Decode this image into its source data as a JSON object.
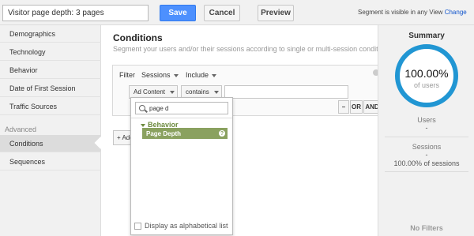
{
  "topbar": {
    "segment_name": "Visitor page depth: 3 pages",
    "save_label": "Save",
    "cancel_label": "Cancel",
    "preview_label": "Preview",
    "visibility_text": "Segment is visible in any View",
    "change_label": "Change"
  },
  "sidebar": {
    "items": [
      {
        "label": "Demographics"
      },
      {
        "label": "Technology"
      },
      {
        "label": "Behavior"
      },
      {
        "label": "Date of First Session"
      },
      {
        "label": "Traffic Sources"
      }
    ],
    "advanced_heading": "Advanced",
    "advanced_items": [
      {
        "label": "Conditions",
        "active": true
      },
      {
        "label": "Sequences"
      }
    ]
  },
  "main": {
    "title": "Conditions",
    "subtitle": "Segment your users and/or their sessions according to single or multi-session conditions.",
    "filter": {
      "label": "Filter",
      "scope": "Sessions",
      "mode": "Include",
      "dimension": "Ad Content",
      "operator": "contains",
      "value": "",
      "minus_label": "–",
      "or_label": "OR",
      "and_label": "AND"
    },
    "add_label": "+ Add"
  },
  "dropdown": {
    "search_value": "page d",
    "group_label": "Behavior",
    "item_label": "Page Depth",
    "help_glyph": "?",
    "alphabetical_label": "Display as alphabetical list"
  },
  "summary": {
    "title": "Summary",
    "percent": "100.00%",
    "percent_sub": "of users",
    "users_label": "Users",
    "users_value": "-",
    "sessions_label": "Sessions",
    "sessions_value": "-",
    "sessions_pct": "100.00% of sessions",
    "no_filters": "No Filters",
    "ring_color": "#2196d3"
  },
  "icons": {
    "search": "search-icon",
    "close": "close-icon",
    "help": "help-icon"
  }
}
